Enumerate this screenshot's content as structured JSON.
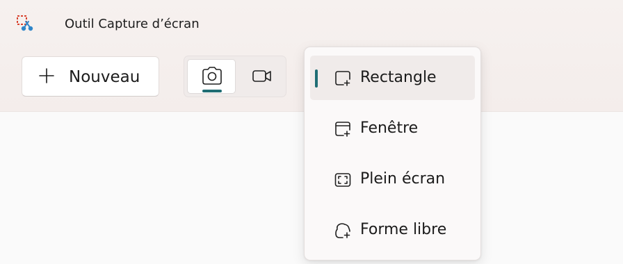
{
  "app": {
    "title": "Outil Capture d’écran",
    "icon": "snipping-tool-icon"
  },
  "toolbar": {
    "new_label": "Nouveau",
    "new_icon": "plus-icon",
    "modes": [
      {
        "name": "photo",
        "icon": "camera-icon",
        "selected": true
      },
      {
        "name": "video",
        "icon": "video-camera-icon",
        "selected": false
      }
    ]
  },
  "menu": {
    "items": [
      {
        "label": "Rectangle",
        "icon": "rectangle-snip-icon",
        "selected": true
      },
      {
        "label": "Fenêtre",
        "icon": "window-snip-icon",
        "selected": false
      },
      {
        "label": "Plein écran",
        "icon": "fullscreen-snip-icon",
        "selected": false
      },
      {
        "label": "Forme libre",
        "icon": "freeform-snip-icon",
        "selected": false
      }
    ]
  },
  "colors": {
    "accent": "#1f6d74",
    "chrome": "#f5efed",
    "menu_bg": "#fbf9f9",
    "selected_bg": "#f0ebea"
  }
}
